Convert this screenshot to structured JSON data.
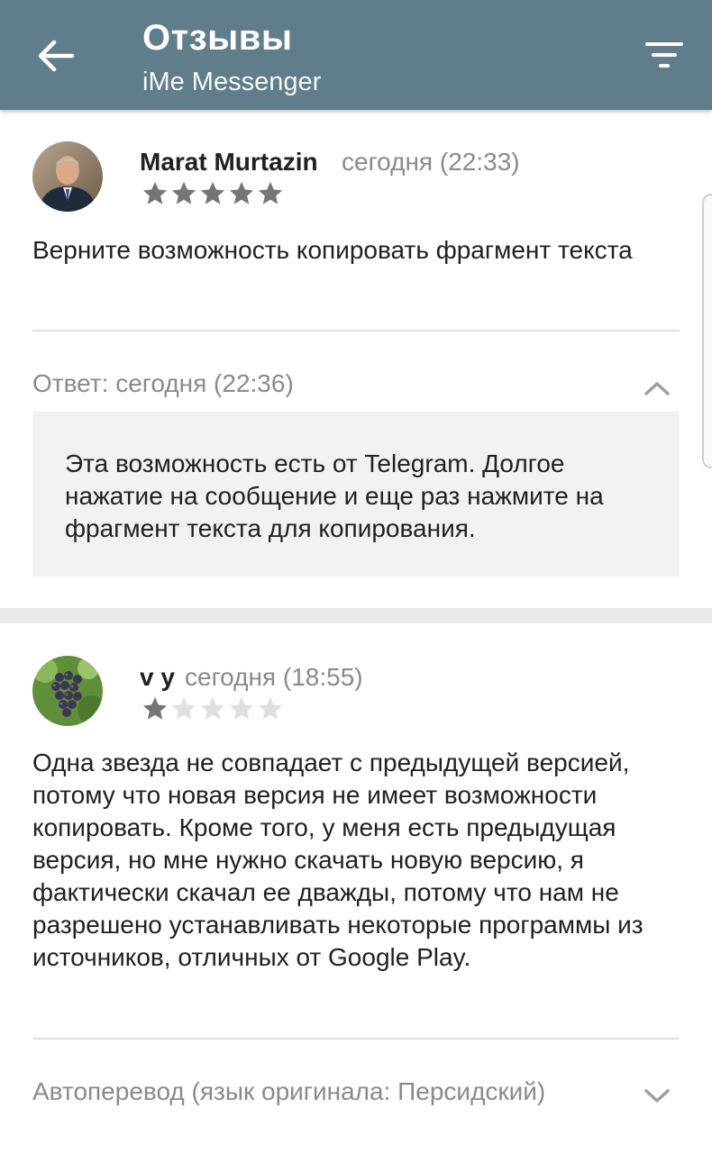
{
  "header": {
    "title": "Отзывы",
    "subtitle": "iMe Messenger",
    "back_icon": "arrow-back-icon",
    "filter_icon": "filter-list-icon",
    "background": "#607d8b"
  },
  "reviews": [
    {
      "author": "Marat Murtazin",
      "date": "сегодня (22:33)",
      "rating": 5,
      "max_rating": 5,
      "text": "Верните возможность копировать фрагмент текста",
      "reply": {
        "header": "Ответ: сегодня (22:36)",
        "text": "Эта возможность есть от Telegram. Долгое нажатие на сообщение и еще раз нажмите на фрагмент текста для копирования.",
        "expanded": true
      }
    },
    {
      "author": "v y",
      "date": "сегодня (18:55)",
      "rating": 1,
      "max_rating": 5,
      "text": "Одна звезда не совпадает с предыдущей версией, потому что новая версия не имеет возможности копировать. Кроме того, у меня есть предыдущая версия, но мне нужно скачать новую версию, я фактически скачал ее дважды, потому что нам не разрешено устанавливать некоторые программы из источников, отличных от Google Play.",
      "translation": {
        "label": "Автоперевод (язык оригинала: Персидский)",
        "expanded": false
      }
    }
  ],
  "colors": {
    "star_filled": "#757575",
    "star_empty": "#e0e0e0",
    "muted_text": "#8a8a8a"
  }
}
